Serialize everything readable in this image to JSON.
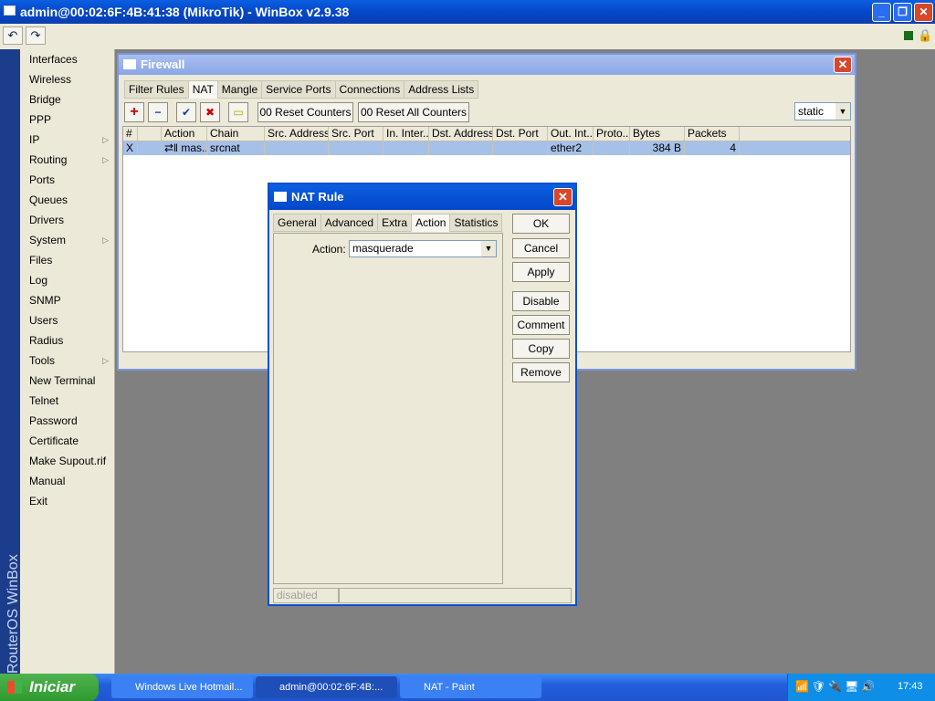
{
  "app": {
    "title": "admin@00:02:6F:4B:41:38 (MikroTik) - WinBox v2.9.38",
    "brand": "RouterOS WinBox"
  },
  "menu": [
    {
      "label": "Interfaces"
    },
    {
      "label": "Wireless"
    },
    {
      "label": "Bridge"
    },
    {
      "label": "PPP"
    },
    {
      "label": "IP",
      "sub": true
    },
    {
      "label": "Routing",
      "sub": true
    },
    {
      "label": "Ports"
    },
    {
      "label": "Queues"
    },
    {
      "label": "Drivers"
    },
    {
      "label": "System",
      "sub": true
    },
    {
      "label": "Files"
    },
    {
      "label": "Log"
    },
    {
      "label": "SNMP"
    },
    {
      "label": "Users"
    },
    {
      "label": "Radius"
    },
    {
      "label": "Tools",
      "sub": true
    },
    {
      "label": "New Terminal"
    },
    {
      "label": "Telnet"
    },
    {
      "label": "Password"
    },
    {
      "label": "Certificate"
    },
    {
      "label": "Make Supout.rif"
    },
    {
      "label": "Manual"
    },
    {
      "label": "Exit"
    }
  ],
  "firewall": {
    "title": "Firewall",
    "tabs": [
      "Filter Rules",
      "NAT",
      "Mangle",
      "Service Ports",
      "Connections",
      "Address Lists"
    ],
    "reset_counters": "00 Reset Counters",
    "reset_all": "00 Reset All Counters",
    "filter": "static",
    "columns": [
      "#",
      "",
      "Action",
      "Chain",
      "Src. Address",
      "Src. Port",
      "In. Inter...",
      "Dst. Address",
      "Dst. Port",
      "Out. Int...",
      "Proto...",
      "Bytes",
      "Packets"
    ],
    "rows": [
      [
        "X",
        "",
        "⇄‖ mas...",
        "srcnat",
        "",
        "",
        "",
        "",
        "",
        "ether2",
        "",
        "384 B",
        "4"
      ]
    ]
  },
  "nat_rule": {
    "title": "NAT Rule",
    "tabs": [
      "General",
      "Advanced",
      "Extra",
      "Action",
      "Statistics"
    ],
    "action_label": "Action:",
    "action_value": "masquerade",
    "buttons": [
      "OK",
      "Cancel",
      "Apply",
      "Disable",
      "Comment",
      "Copy",
      "Remove"
    ],
    "status": "disabled"
  },
  "taskbar": {
    "start": "Iniciar",
    "tasks": [
      "Windows Live Hotmail...",
      "admin@00:02:6F:4B:...",
      "NAT - Paint"
    ],
    "clock": "17:43"
  }
}
